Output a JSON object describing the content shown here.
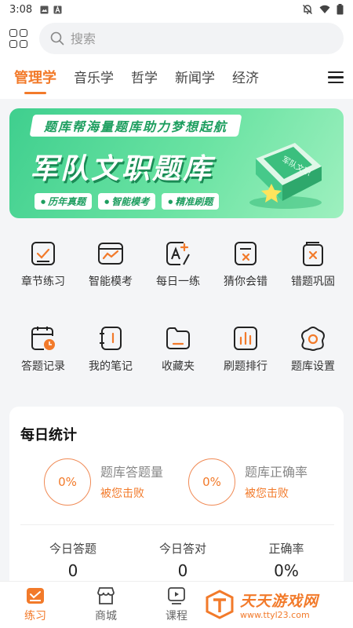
{
  "status_bar": {
    "time": "3:08"
  },
  "header": {
    "search_placeholder": "搜索"
  },
  "tabs": [
    {
      "label": "管理学",
      "active": true
    },
    {
      "label": "音乐学"
    },
    {
      "label": "哲学"
    },
    {
      "label": "新闻学"
    },
    {
      "label": "经济"
    }
  ],
  "banner": {
    "slogan": "题库帮海量题库助力梦想起航",
    "title": "军队文职题库",
    "tags": [
      "历年真题",
      "智能模考",
      "精准刷题"
    ],
    "book_text": "军队文职"
  },
  "features": [
    {
      "label": "章节练习",
      "icon": "checkbox-icon"
    },
    {
      "label": "智能模考",
      "icon": "chart-icon"
    },
    {
      "label": "每日一练",
      "icon": "a-plus-icon"
    },
    {
      "label": "猜你会错",
      "icon": "doc-x-icon"
    },
    {
      "label": "错题巩固",
      "icon": "book-x-icon"
    },
    {
      "label": "答题记录",
      "icon": "clipboard-clock-icon"
    },
    {
      "label": "我的笔记",
      "icon": "notebook-icon"
    },
    {
      "label": "收藏夹",
      "icon": "folder-icon"
    },
    {
      "label": "刷题排行",
      "icon": "bar-chart-icon"
    },
    {
      "label": "题库设置",
      "icon": "settings-icon"
    }
  ],
  "stats": {
    "title": "每日统计",
    "answer_count": {
      "value": "0%",
      "label": "题库答题量",
      "sub": "被您击败"
    },
    "accuracy": {
      "value": "0%",
      "label": "题库正确率",
      "sub": "被您击败"
    },
    "daily": [
      {
        "label": "今日答题",
        "value": "0"
      },
      {
        "label": "今日答对",
        "value": "0"
      },
      {
        "label": "正确率",
        "value": "0%"
      }
    ]
  },
  "bottom_nav": [
    {
      "label": "练习",
      "active": true
    },
    {
      "label": "商城"
    },
    {
      "label": "课程"
    }
  ],
  "watermark": {
    "title": "天天游戏网",
    "url": "www.ttyl23.com"
  },
  "colors": {
    "accent": "#f27a2a",
    "banner_green": "#3fcf8e"
  }
}
